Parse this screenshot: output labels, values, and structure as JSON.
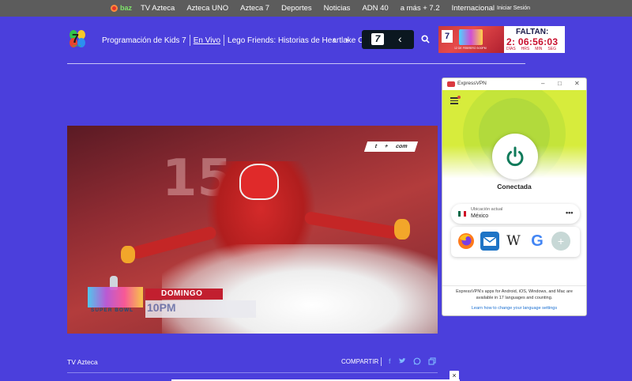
{
  "topbar": {
    "brand": "baz",
    "nav": [
      "TV Azteca",
      "Azteca UNO",
      "Azteca 7",
      "Deportes",
      "Noticias",
      "ADN 40",
      "a más + 7.2",
      "Internacional"
    ],
    "signin": "Iniciar Sesión"
  },
  "header": {
    "logo_small": "azteca",
    "nav": [
      "Programación de Kids 7",
      "En Vivo",
      "Lego Friends: Historias de Heartlake C"
    ],
    "active_index": 1,
    "channel_badge": "7"
  },
  "countdown": {
    "badge": "7",
    "date_text": "12 DE FEBRERO 5:00PM",
    "label": "FALTAN:",
    "timer": "2: 06:56:03",
    "units": [
      "DÍAS",
      "HRS",
      "MIN",
      "SEG"
    ]
  },
  "video": {
    "jersey_number": "15",
    "net_logo": [
      "t",
      "+",
      "com"
    ],
    "event_text": "SUPER BOWL",
    "day": "DOMINGO",
    "time": "10PM"
  },
  "footer": {
    "channel": "TV Azteca",
    "share": "COMPARTIR",
    "social_icons": [
      "facebook-icon",
      "twitter-icon",
      "whatsapp-icon",
      "copy-icon"
    ],
    "close": "×"
  },
  "vpn": {
    "title": "ExpressVPN",
    "status": "Conectada",
    "location_label": "Ubicación actual",
    "location_value": "México",
    "more": "•••",
    "shortcuts": [
      "firefox-icon",
      "mail-icon",
      "wikipedia-icon",
      "google-icon",
      "add-shortcut-icon"
    ],
    "wiki_letter": "W",
    "google_letter": "G",
    "add_letter": "+",
    "note": "ExpressVPN's apps for Android, iOS, Windows, and Mac are available in 17 languages and counting.",
    "link": "Learn how to change your language settings",
    "colors": {
      "hero": "#d7ec3c",
      "power": "#0f7a5a",
      "accent": "#da3940"
    }
  }
}
